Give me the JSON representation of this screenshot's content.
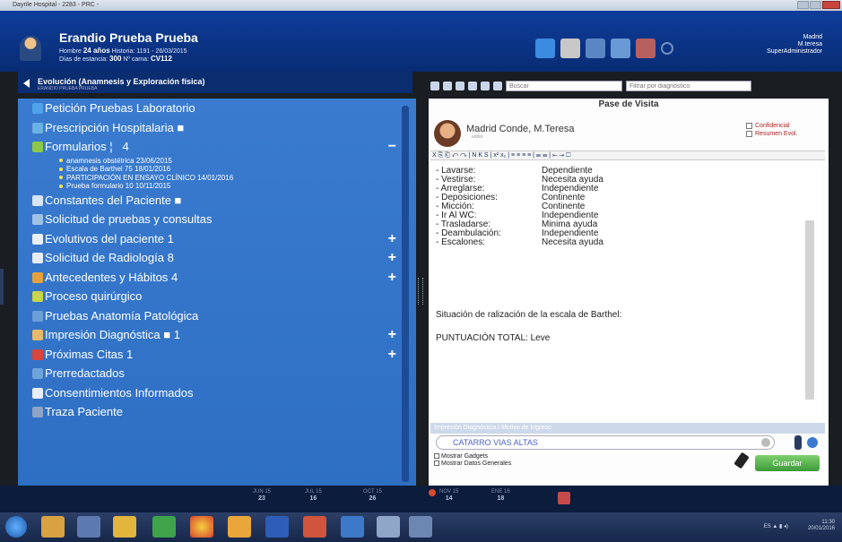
{
  "window": {
    "title": "Dayrile Hospital - 2283 - PRC -"
  },
  "patient": {
    "name": "Erandio Prueba Prueba",
    "line1_label": "Hombre",
    "age": "24 años",
    "line1_rest": "Historia: 1191 - 26/03/2015",
    "line2_label": "Días de estancia:",
    "bed": "300",
    "line2_rest": "Nº cama:",
    "cama": "CV112"
  },
  "user": {
    "line1": "Madrid",
    "line2": "M.teresa",
    "line3": "SuperAdministrador"
  },
  "evolucion": {
    "title": "Evolución (Anamnesis y Exploración física)",
    "subtitle": "ERANDIO PRUEBA PRUEBA"
  },
  "toolbar": {
    "search_placeholder": "Buscar",
    "filter_placeholder": "Filtrar por diagnóstico"
  },
  "menu": {
    "items": [
      {
        "label": "Petición Pruebas Laboratorio",
        "badge": ""
      },
      {
        "label": "Prescripción Hospitalaria",
        "badge": ""
      },
      {
        "label": "Formularios",
        "badge": "4"
      },
      {
        "label": "Constantes del Paciente",
        "badge": ""
      },
      {
        "label": "Solicitud de pruebas y consultas",
        "badge": ""
      },
      {
        "label": "Evolutivos del paciente",
        "badge": "1"
      },
      {
        "label": "Solicitud de Radiología",
        "badge": "8"
      },
      {
        "label": "Antecedentes y Hábitos",
        "badge": "4"
      },
      {
        "label": "Proceso quirúrgico",
        "badge": ""
      },
      {
        "label": "Pruebas Anatomía Patológica",
        "badge": ""
      },
      {
        "label": "Impresión Diagnóstica",
        "badge": "1"
      },
      {
        "label": "Próximas Citas",
        "badge": "1"
      },
      {
        "label": "Prerredactados",
        "badge": ""
      },
      {
        "label": "Consentimientos Informados",
        "badge": ""
      },
      {
        "label": "Traza Paciente",
        "badge": ""
      }
    ],
    "formularios": [
      "anamnesis obstétrica   23/06/2015",
      "Escala de Barthel  75  18/01/2016",
      "PARTICIPACIÓN EN ENSAYO CLÍNICO    14/01/2016",
      "Prueba formulario  10  10/11/2015"
    ]
  },
  "note": {
    "header": "Pase de Visita",
    "doctor": "Madrid Conde, M.Teresa",
    "role": "editor",
    "confidencial": "Confidencial",
    "resumen": "Resumen Evol.",
    "editor_tools": "X  ⎘  ⎗  ↶  ↷  |  N  K  S  |  x²  x₂  |  ≡  ≡  ≡  ≡  |  ☰  ☰  |  ⇤  ⇥  ☐",
    "rows": [
      {
        "k": "- Lavarse:",
        "v": "Dependiente"
      },
      {
        "k": "- Vestirse:",
        "v": "Necesita ayuda"
      },
      {
        "k": "- Arreglarse:",
        "v": "Independiente"
      },
      {
        "k": "- Deposiciones:",
        "v": "Continente"
      },
      {
        "k": "- Micción:",
        "v": "Continente"
      },
      {
        "k": "- Ir Al WC:",
        "v": "Independiente"
      },
      {
        "k": "- Trasladarse:",
        "v": "Minima ayuda"
      },
      {
        "k": "- Deambulación:",
        "v": "Independiente"
      },
      {
        "k": "- Escalones:",
        "v": "Necesita ayuda"
      }
    ],
    "para1": "Situación de ralización de la escala de Barthel:",
    "para2": "PUNTUACIÓN TOTAL: Leve",
    "imp_label": "Impresión Diagnóstica / Motivo de Ingreso",
    "imp_value": "CATARRO VIAS ALTAS",
    "gadgets": "Mostrar Gadgets",
    "datos": "Mostrar Datos Generales",
    "save": "Guardar"
  },
  "timeline": [
    {
      "m": "JUN 15",
      "d": "23"
    },
    {
      "m": "JUL 15",
      "d": "16"
    },
    {
      "m": "OCT 15",
      "d": "26"
    },
    {
      "m": "NOV 15",
      "d": "14"
    },
    {
      "m": "ENE 16",
      "d": "18"
    }
  ],
  "clock": {
    "time": "11:30",
    "date": "20/01/2016"
  }
}
